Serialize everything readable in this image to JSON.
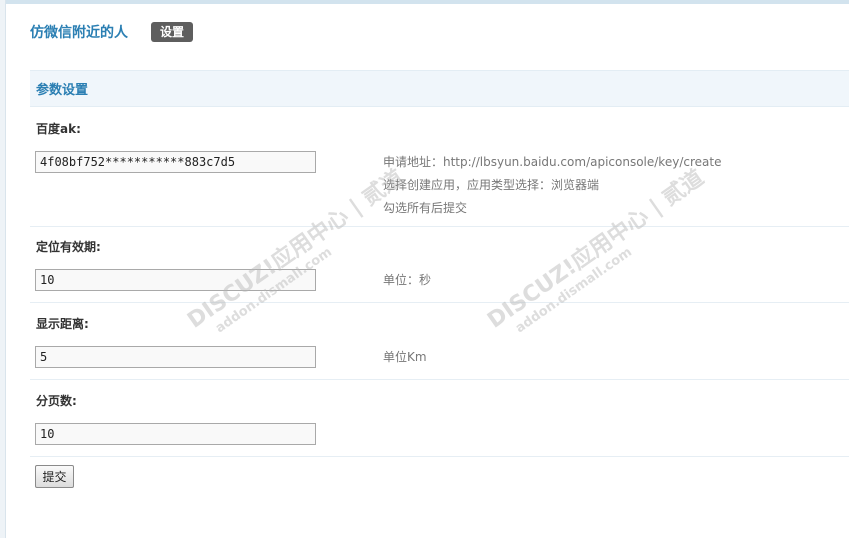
{
  "header": {
    "title": "仿微信附近的人",
    "settings_label": "设置"
  },
  "section": {
    "title": "参数设置"
  },
  "fields": {
    "baidu_ak": {
      "label": "百度ak:",
      "value": "4f08bf752***********883c7d5",
      "hints": [
        "申请地址：http://lbsyun.baidu.com/apiconsole/key/create",
        "选择创建应用，应用类型选择：浏览器端",
        "勾选所有后提交"
      ]
    },
    "validity": {
      "label": "定位有效期:",
      "value": "10",
      "hint": "单位：秒"
    },
    "distance": {
      "label": "显示距离:",
      "value": "5",
      "hint": "单位Km"
    },
    "page_size": {
      "label": "分页数:",
      "value": "10"
    }
  },
  "submit_label": "提交",
  "watermark": {
    "main": "DISCUZ!应用中心 | 贰道",
    "sub": "addon.dismall.com"
  }
}
